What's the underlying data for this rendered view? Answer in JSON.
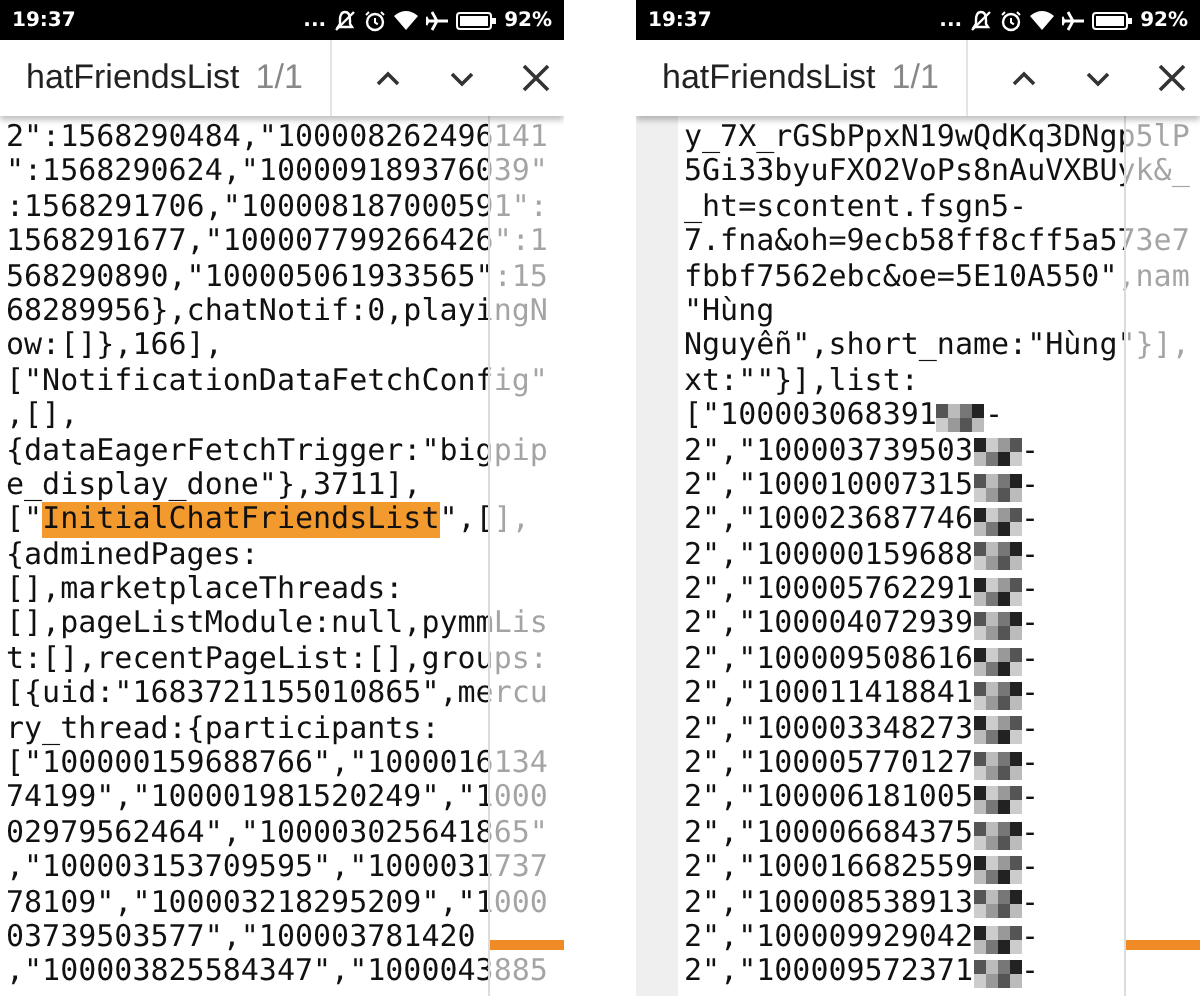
{
  "screens": [
    {
      "status_bar": {
        "time": "19:37",
        "more": "...",
        "battery": "92%"
      },
      "find_bar": {
        "query": "hatFriendsList",
        "count": "1/1"
      },
      "gutter": false,
      "code_lines": [
        {
          "text": "2\":1568290484,\"100008262496141"
        },
        {
          "text": "\":1568290624,\"100009189376039\""
        },
        {
          "text": ":1568291706,\"100008187000591\":"
        },
        {
          "text": "1568291677,\"100007799266426\":1"
        },
        {
          "text": "568290890,\"100005061933565\":15"
        },
        {
          "text": "68289956},chatNotif:0,playingN"
        },
        {
          "text": "ow:[]},166],"
        },
        {
          "text": "[\"NotificationDataFetchConfig\""
        },
        {
          "text": ",[],"
        },
        {
          "text": "{dataEagerFetchTrigger:\"bigpip"
        },
        {
          "text": "e_display_done\"},3711],"
        },
        {
          "text": "[\"",
          "match": "InitialChatFriendsList",
          "after": "\",[],"
        },
        {
          "text": "{adminedPages:"
        },
        {
          "text": "[],marketplaceThreads:"
        },
        {
          "text": "[],pageListModule:null,pymmLis"
        },
        {
          "text": "t:[],recentPageList:[],groups:"
        },
        {
          "text": "[{uid:\"1683721155010865\",mercu"
        },
        {
          "text": "ry_thread:{participants:"
        },
        {
          "text": "[\"100000159688766\",\"1000016134"
        },
        {
          "text": "74199\",\"100001981520249\",\"1000"
        },
        {
          "text": "02979562464\",\"100003025641865\""
        },
        {
          "text": ",\"100003153709595\",\"1000031737"
        },
        {
          "text": "78109\",\"100003218295209\",\"1000"
        },
        {
          "text": "03739503577\",\"100003781420"
        },
        {
          "text": ",\"100003825584347\",\"1000043885"
        }
      ]
    },
    {
      "status_bar": {
        "time": "19:37",
        "more": "...",
        "battery": "92%"
      },
      "find_bar": {
        "query": "hatFriendsList",
        "count": "1/1"
      },
      "gutter": true,
      "code_lines": [
        {
          "text": "y_7X_rGSbPpxN19wQdKq3DNgp5lP"
        },
        {
          "text": "5Gi33byuFXO2VoPs8nAuVXBUyk&_"
        },
        {
          "text": "_ht=scontent.fsgn5-"
        },
        {
          "text": "7.fna&oh=9ecb58ff8cff5a573e7"
        },
        {
          "text": "fbbf7562ebc&oe=5E10A550\",nam"
        },
        {
          "text": "\"Hùng"
        },
        {
          "text": "Nguyễn\",short_name:\"Hùng\"}],"
        },
        {
          "text": "xt:\"\"}],list:"
        },
        {
          "text": "[\"100003068391",
          "redacted": true,
          "after": "-"
        },
        {
          "text": "2\",\"100003739503",
          "redacted": true,
          "after": "-"
        },
        {
          "text": "2\",\"100010007315",
          "redacted": true,
          "after": "-"
        },
        {
          "text": "2\",\"100023687746",
          "redacted": true,
          "after": "-"
        },
        {
          "text": "2\",\"100000159688",
          "redacted": true,
          "after": "-"
        },
        {
          "text": "2\",\"100005762291",
          "redacted": true,
          "after": "-"
        },
        {
          "text": "2\",\"100004072939",
          "redacted": true,
          "after": "-"
        },
        {
          "text": "2\",\"100009508616",
          "redacted": true,
          "after": "-"
        },
        {
          "text": "2\",\"100011418841",
          "redacted": true,
          "after": "-"
        },
        {
          "text": "2\",\"100003348273",
          "redacted": true,
          "after": "-"
        },
        {
          "text": "2\",\"100005770127",
          "redacted": true,
          "after": "-"
        },
        {
          "text": "2\",\"100006181005",
          "redacted": true,
          "after": "-"
        },
        {
          "text": "2\",\"100006684375",
          "redacted": true,
          "after": "-"
        },
        {
          "text": "2\",\"100016682559",
          "redacted": true,
          "after": "-"
        },
        {
          "text": "2\",\"100008538913",
          "redacted": true,
          "after": "-"
        },
        {
          "text": "2\",\"100009929042",
          "redacted": true,
          "after": "-"
        },
        {
          "text": "2\",\"100009572371",
          "redacted": true,
          "after": "-"
        }
      ]
    }
  ]
}
